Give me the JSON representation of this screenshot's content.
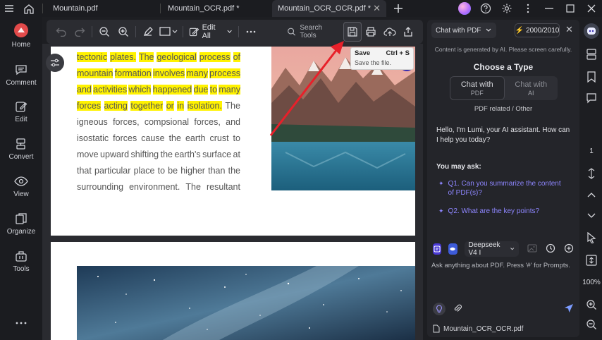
{
  "titlebar": {
    "tabs": [
      {
        "label": "Mountain.pdf"
      },
      {
        "label": "Mountain_OCR.pdf *"
      },
      {
        "label": "Mountain_OCR_OCR.pdf *"
      }
    ]
  },
  "leftrail": {
    "items": [
      {
        "label": "Home"
      },
      {
        "label": "Comment"
      },
      {
        "label": "Edit"
      },
      {
        "label": "Convert"
      },
      {
        "label": "View"
      },
      {
        "label": "Organize"
      },
      {
        "label": "Tools"
      }
    ]
  },
  "toolbar": {
    "edit_all_label": "Edit All",
    "search_tools_label": "Search Tools"
  },
  "tooltip": {
    "title": "Save",
    "shortcut": "Ctrl + S",
    "description": "Save the file."
  },
  "document": {
    "lines": [
      [
        "tectonic",
        "plates.",
        "The",
        "geological",
        "process",
        "of"
      ],
      [
        "mountain",
        "formation",
        "involves",
        "many",
        "process"
      ],
      [
        "and",
        "activities",
        "which",
        "happened",
        "due",
        "to",
        "many"
      ],
      [
        "forces",
        "acting",
        "together",
        "or",
        "in",
        "isolation.",
        "The"
      ],
      [
        "igneous",
        "forces,",
        "compsional",
        "forces,",
        "and"
      ],
      [
        "isostatic",
        "forces",
        "cause",
        "the",
        "earth",
        "crust",
        "to"
      ],
      [
        "move",
        "upward",
        "shifting",
        "the",
        "earth's",
        "surface",
        "at"
      ],
      [
        "that",
        "particular",
        "place",
        "to",
        "be",
        "higher",
        "than",
        "the"
      ],
      [
        "surrounding",
        "environment.",
        "The",
        "resultant"
      ]
    ]
  },
  "panel": {
    "chat_selector": "Chat with PDF",
    "credits": "2000/2010",
    "notice": "Content is generated by AI. Please screen carefully.",
    "choose_type": "Choose a Type",
    "type_options": [
      {
        "label": "Chat with",
        "sub": "PDF"
      },
      {
        "label": "Chat with",
        "sub": "AI"
      }
    ],
    "type_hint": "PDF related / Other",
    "greeting": "Hello, I'm Lumi, your AI assistant. How can I help you today?",
    "you_may_ask": "You may ask:",
    "questions": [
      "Q1. Can you summarize the content of PDF(s)?",
      "Q2. What are the key points?"
    ],
    "model": "Deepseek V4 I",
    "prompt_placeholder": "Ask anything about PDF. Press '#' for Prompts.",
    "file_name": "Mountain_OCR_OCR.pdf"
  },
  "rightrail": {
    "page_number": "1",
    "zoom": "100%"
  },
  "colors": {
    "highlight": "#fff200",
    "accent": "#8e86ff",
    "annotation_arrow": "#e8202a"
  }
}
